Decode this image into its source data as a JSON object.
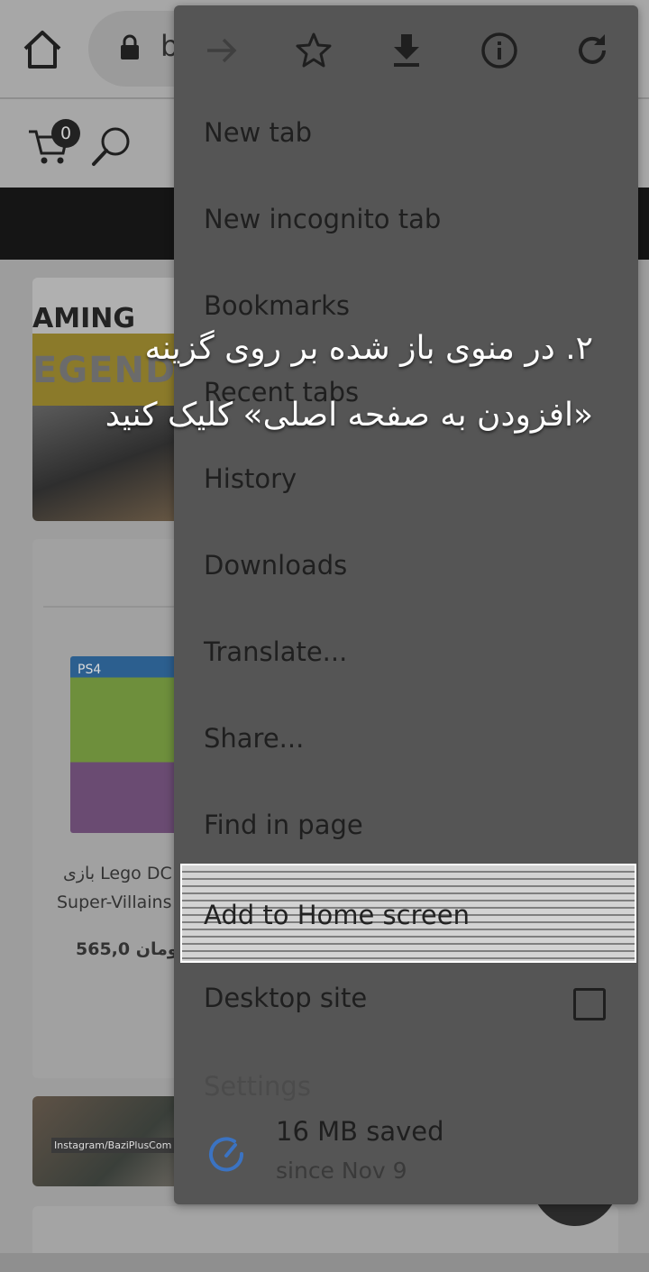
{
  "browser": {
    "url_partial": "b"
  },
  "site": {
    "cart_count": "0",
    "banner_text": "AMING",
    "banner_legend": "EGEND",
    "product": {
      "platform_badge": "PS4",
      "title_line1": "بازی Lego DC",
      "title_line2": "Super-Villains",
      "price": "565,0",
      "currency": "تومان"
    },
    "watermark": "Instagram/BaziPlusCom"
  },
  "menu": {
    "items": [
      {
        "label": "New tab"
      },
      {
        "label": "New incognito tab"
      },
      {
        "label": "Bookmarks"
      },
      {
        "label": "Recent tabs"
      },
      {
        "label": "History"
      },
      {
        "label": "Downloads"
      },
      {
        "label": "Translate..."
      },
      {
        "label": "Share..."
      },
      {
        "label": "Find in page"
      },
      {
        "label": "Add to Home screen"
      },
      {
        "label": "Desktop site"
      },
      {
        "label": "Settings"
      }
    ],
    "data_saver": {
      "main": "16 MB saved",
      "sub": "since Nov 9"
    }
  },
  "instruction": {
    "line1": "۲. در منوی باز شده بر روی گزینه",
    "line2": "«افزودن به صفحه اصلی» کلیک کنید"
  },
  "colors": {
    "highlight_border": "#ffffff",
    "data_saver_icon": "#3b73c2"
  }
}
